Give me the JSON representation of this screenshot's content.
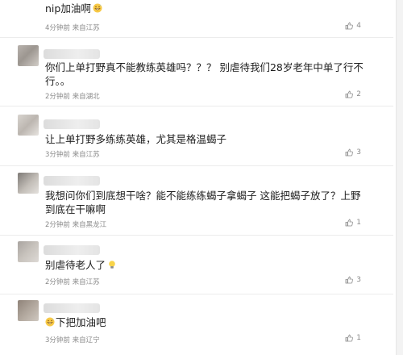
{
  "comments": [
    {
      "text": "nip加油啊",
      "emoji": "grinning-sweat-emoji",
      "meta": "4分钟前 来自江苏",
      "likes": "4"
    },
    {
      "text": "你们上单打野真不能教练英雄吗？？？ 别虐待我们28岁老年中单了行不行。。",
      "meta": "2分钟前 来自湖北",
      "likes": "2"
    },
    {
      "text": "让上单打野多练练英雄，尤其是格温蝎子",
      "meta": "3分钟前 来自江苏",
      "likes": "3"
    },
    {
      "text": "我想问你们到底想干啥？能不能练练蝎子拿蝎子 这能把蝎子放了？上野到底在干嘛啊",
      "meta": "2分钟前 来自黑龙江",
      "likes": "1"
    },
    {
      "text": "别虐待老人了",
      "emoji": "lightbulb-emoji",
      "meta": "2分钟前 来自江苏",
      "likes": "3"
    },
    {
      "text": "下把加油吧",
      "emoji": "grinning-sweat-emoji",
      "meta": "3分钟前 来自辽宁",
      "likes": "1"
    }
  ]
}
